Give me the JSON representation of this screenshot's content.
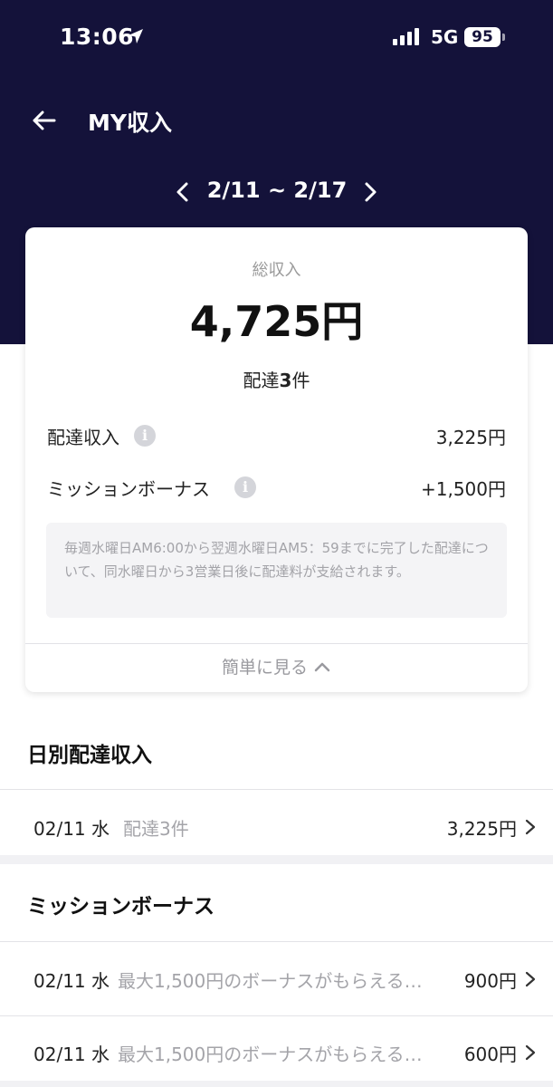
{
  "status_bar": {
    "time": "13:06",
    "network": "5G",
    "battery": "95",
    "location_icon": "location-arrow-icon",
    "signal_icon": "cellular-signal-icon"
  },
  "header": {
    "title": "MY収入",
    "back_icon": "arrow-left-icon",
    "date_range": "2/11 ~ 2/17",
    "prev_icon": "chevron-left-icon",
    "next_icon": "chevron-right-icon",
    "background_color": "#14123a"
  },
  "summary": {
    "total_label": "総収入",
    "total_value": "4,725円",
    "delivery_prefix": "配達",
    "delivery_count": "3",
    "delivery_suffix": "件",
    "rows": [
      {
        "label": "配達収入",
        "value": "3,225円",
        "info_icon": "info-icon"
      },
      {
        "label": "ミッションボーナス",
        "value": "+1,500円",
        "info_icon": "info-icon"
      }
    ],
    "note": "毎週水曜日AM6:00から翌週水曜日AM5：59までに完了した配達について、同水曜日から3営業日後に配達料が支給されます。",
    "collapse_label": "簡単に見る",
    "collapse_icon": "chevron-up-icon"
  },
  "daily": {
    "title": "日別配達収入",
    "items": [
      {
        "date": "02/11 水",
        "desc": "配達3件",
        "amount": "3,225円"
      }
    ]
  },
  "mission": {
    "title": "ミッションボーナス",
    "items": [
      {
        "date": "02/11 水",
        "desc": "最大1,500円のボーナスがもらえる…",
        "amount": "900円"
      },
      {
        "date": "02/11 水",
        "desc": "最大1,500円のボーナスがもらえる…",
        "amount": "600円"
      }
    ]
  }
}
